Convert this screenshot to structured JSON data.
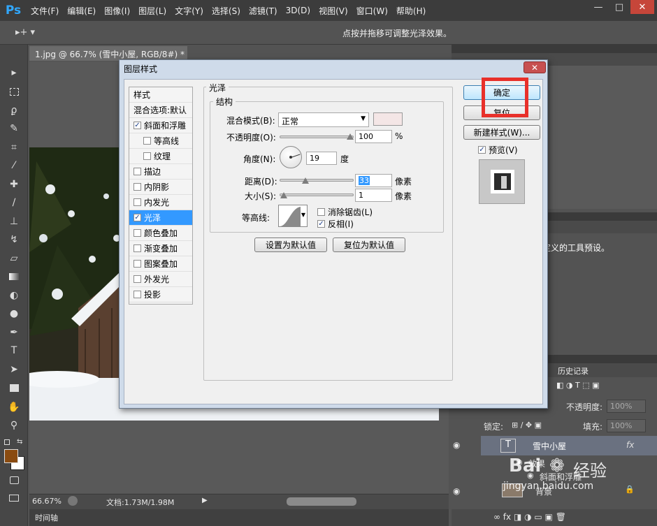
{
  "app": {
    "logo": "Ps",
    "menu": [
      "文件(F)",
      "编辑(E)",
      "图像(I)",
      "图层(L)",
      "文字(Y)",
      "选择(S)",
      "滤镜(T)",
      "3D(D)",
      "视图(V)",
      "窗口(W)",
      "帮助(H)"
    ],
    "window_buttons": [
      "—",
      "□",
      "✕"
    ]
  },
  "options_bar": {
    "tool_icon": "move-tool-icon",
    "tool_glyph": "▸+ ▾",
    "hint": "点按并拖移可调整光泽效果。"
  },
  "document": {
    "tab_title": "1.jpg @ 66.7% (雪中小屋, RGB/8#) *",
    "tab_close": "×",
    "zoom": "66.67%",
    "doc_info": "文档:1.73M/1.98M",
    "timeline_label": "时间轴"
  },
  "right_panel": {
    "tool_preset_text": "定义的工具预设。",
    "history_tab": "历史记录",
    "opacity_label": "不透明度:",
    "opacity_value": "100%",
    "lock_label": "锁定:",
    "fill_label": "填充:",
    "fill_value": "100%",
    "layers": [
      {
        "name": "雪中小屋",
        "type_glyph": "T",
        "badge": "fx"
      },
      {
        "name": "效果"
      },
      {
        "name": "斜面和浮雕"
      },
      {
        "name": "背景"
      }
    ]
  },
  "dialog": {
    "title": "图层样式",
    "close_glyph": "✕",
    "styles_header": "样式",
    "blend_options": "混合选项:默认",
    "styles": [
      {
        "label": "斜面和浮雕",
        "checked": true,
        "indent": false
      },
      {
        "label": "等高线",
        "checked": false,
        "indent": true
      },
      {
        "label": "纹理",
        "checked": false,
        "indent": true
      },
      {
        "label": "描边",
        "checked": false,
        "indent": false
      },
      {
        "label": "内阴影",
        "checked": false,
        "indent": false
      },
      {
        "label": "内发光",
        "checked": false,
        "indent": false
      },
      {
        "label": "光泽",
        "checked": true,
        "indent": false,
        "selected": true
      },
      {
        "label": "颜色叠加",
        "checked": false,
        "indent": false
      },
      {
        "label": "渐变叠加",
        "checked": false,
        "indent": false
      },
      {
        "label": "图案叠加",
        "checked": false,
        "indent": false
      },
      {
        "label": "外发光",
        "checked": false,
        "indent": false
      },
      {
        "label": "投影",
        "checked": false,
        "indent": false
      }
    ],
    "satin": {
      "group_title": "光泽",
      "structure_title": "结构",
      "blend_mode_label": "混合模式(B):",
      "blend_mode_value": "正常",
      "color_swatch": "#f4e6e6",
      "opacity_label": "不透明度(O):",
      "opacity_value": "100",
      "opacity_unit": "%",
      "opacity_level": 1.0,
      "angle_label": "角度(N):",
      "angle_value": "19",
      "angle_unit": "度",
      "distance_label": "距离(D):",
      "distance_value": "33",
      "distance_unit": "像素",
      "distance_level": 0.33,
      "size_label": "大小(S):",
      "size_value": "1",
      "size_unit": "像素",
      "size_level": 0.01,
      "contour_label": "等高线:",
      "anti_alias_label": "消除锯齿(L)",
      "anti_alias_checked": false,
      "invert_label": "反相(I)",
      "invert_checked": true,
      "set_default_btn": "设置为默认值",
      "reset_default_btn": "复位为默认值"
    },
    "ok_btn": "确定",
    "reset_btn": "复位",
    "new_style_btn": "新建样式(W)...",
    "preview_label": "预览(V)",
    "preview_checked": true,
    "highlight_color": "#e8302a"
  },
  "watermark": {
    "brand": "Bai",
    "brand_suffix": "经验",
    "url": "jingyan.baidu.com"
  }
}
